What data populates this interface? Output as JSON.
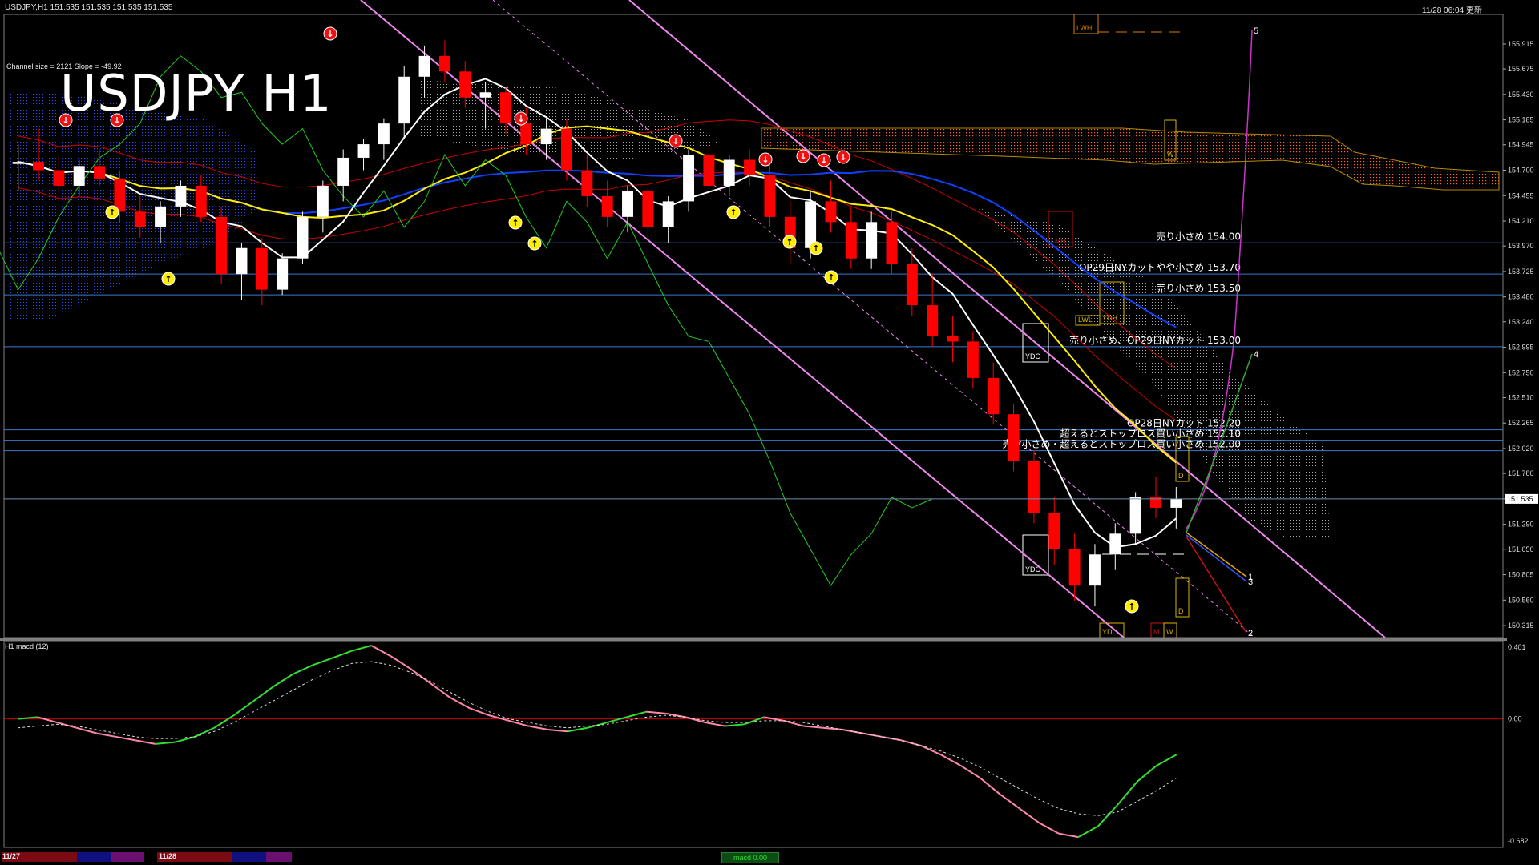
{
  "header": {
    "symbol_info": "USDJPY,H1  151.535 151.535 151.535 151.535",
    "timestamp": "11/28 06:04 更新",
    "channel_info": "Channel size = 2121 Slope = -49.92",
    "big_title": "USDJPY H1"
  },
  "subwindow": {
    "label": "H1  macd (12)"
  },
  "footer": {
    "dates": [
      "11/27",
      "11/28"
    ],
    "button": "macd 0.00"
  },
  "colors": {
    "bull_candle": "#ffffff",
    "bear_candle": "#ff0000",
    "macd_up": "#33dd33",
    "macd_down": "#ff88aa",
    "signal": "#dddddd",
    "sma_white": "#ffffff",
    "sma_yellow": "#ffee00",
    "sma_blue": "#1040ff",
    "chikou": "#22cc22",
    "envelope": "#cc0000",
    "channel": "#ee88ee",
    "cloud": "#ff6633",
    "level_line": "#3a7ad0",
    "zero_line": "#cc0000"
  },
  "icons": {
    "buy_marker": "up-arrow-circle-icon",
    "sell_marker": "down-arrow-circle-icon"
  },
  "chart_data": [
    {
      "type": "candlestick",
      "title": "USDJPY H1",
      "price_axis": {
        "ylim": [
          150.2,
          156.2
        ],
        "tick_labels": [
          "155.915",
          "155.675",
          "155.430",
          "155.185",
          "154.945",
          "154.700",
          "154.455",
          "154.210",
          "153.970",
          "153.725",
          "153.480",
          "153.240",
          "152.995",
          "152.750",
          "152.510",
          "152.265",
          "152.020",
          "151.780",
          "151.535",
          "151.290",
          "151.050",
          "150.805",
          "150.560",
          "150.315"
        ],
        "current_price": "151.535"
      },
      "horizontal_levels": [
        {
          "price": 154.0,
          "label": "売り小さめ 154.00"
        },
        {
          "price": 153.7,
          "label": "OP29日NYカットやや小さめ 153.70"
        },
        {
          "price": 153.5,
          "label": "売り小さめ 153.50"
        },
        {
          "price": 153.0,
          "label": "売り小さめ、OP29日NYカット 153.00"
        },
        {
          "price": 152.2,
          "label": "OP28日NYカット 152.20"
        },
        {
          "price": 152.1,
          "label": "超えるとストップロス買い小さめ 152.10"
        },
        {
          "price": 152.0,
          "label": "売り小さめ・超えるとストップロス買い小さめ 152.00"
        }
      ],
      "box_labels": [
        "LWH",
        "W",
        "LMH",
        "LWL",
        "YDH",
        "YDO",
        "YDC",
        "D",
        "D",
        "YDL",
        "M",
        "W"
      ],
      "projection_labels": [
        "5",
        "4",
        "1",
        "3",
        "2"
      ],
      "candles": [
        {
          "o": 154.76,
          "h": 154.95,
          "l": 154.5,
          "c": 154.78
        },
        {
          "o": 154.78,
          "h": 155.1,
          "l": 154.6,
          "c": 154.7
        },
        {
          "o": 154.7,
          "h": 154.85,
          "l": 154.4,
          "c": 154.55
        },
        {
          "o": 154.55,
          "h": 154.8,
          "l": 154.45,
          "c": 154.74
        },
        {
          "o": 154.74,
          "h": 154.9,
          "l": 154.55,
          "c": 154.62
        },
        {
          "o": 154.62,
          "h": 154.7,
          "l": 154.2,
          "c": 154.3
        },
        {
          "o": 154.3,
          "h": 154.45,
          "l": 154.05,
          "c": 154.15
        },
        {
          "o": 154.15,
          "h": 154.4,
          "l": 154.0,
          "c": 154.35
        },
        {
          "o": 154.35,
          "h": 154.6,
          "l": 154.25,
          "c": 154.55
        },
        {
          "o": 154.55,
          "h": 154.65,
          "l": 154.2,
          "c": 154.25
        },
        {
          "o": 154.25,
          "h": 154.35,
          "l": 153.6,
          "c": 153.7
        },
        {
          "o": 153.7,
          "h": 154.0,
          "l": 153.45,
          "c": 153.95
        },
        {
          "o": 153.95,
          "h": 154.05,
          "l": 153.4,
          "c": 153.55
        },
        {
          "o": 153.55,
          "h": 153.9,
          "l": 153.5,
          "c": 153.85
        },
        {
          "o": 153.85,
          "h": 154.3,
          "l": 153.8,
          "c": 154.25
        },
        {
          "o": 154.25,
          "h": 154.6,
          "l": 154.1,
          "c": 154.55
        },
        {
          "o": 154.55,
          "h": 154.9,
          "l": 154.4,
          "c": 154.82
        },
        {
          "o": 154.82,
          "h": 155.0,
          "l": 154.7,
          "c": 154.95
        },
        {
          "o": 154.95,
          "h": 155.2,
          "l": 154.8,
          "c": 155.15
        },
        {
          "o": 155.15,
          "h": 155.7,
          "l": 155.0,
          "c": 155.6
        },
        {
          "o": 155.6,
          "h": 155.9,
          "l": 155.4,
          "c": 155.8
        },
        {
          "o": 155.8,
          "h": 155.95,
          "l": 155.55,
          "c": 155.65
        },
        {
          "o": 155.65,
          "h": 155.75,
          "l": 155.3,
          "c": 155.4
        },
        {
          "o": 155.4,
          "h": 155.55,
          "l": 155.1,
          "c": 155.45
        },
        {
          "o": 155.45,
          "h": 155.5,
          "l": 155.05,
          "c": 155.15
        },
        {
          "o": 155.15,
          "h": 155.3,
          "l": 154.85,
          "c": 154.95
        },
        {
          "o": 154.95,
          "h": 155.2,
          "l": 154.8,
          "c": 155.1
        },
        {
          "o": 155.1,
          "h": 155.2,
          "l": 154.6,
          "c": 154.7
        },
        {
          "o": 154.7,
          "h": 154.85,
          "l": 154.35,
          "c": 154.45
        },
        {
          "o": 154.45,
          "h": 154.6,
          "l": 154.15,
          "c": 154.25
        },
        {
          "o": 154.25,
          "h": 154.55,
          "l": 154.1,
          "c": 154.5
        },
        {
          "o": 154.5,
          "h": 154.6,
          "l": 154.05,
          "c": 154.15
        },
        {
          "o": 154.15,
          "h": 154.45,
          "l": 154.0,
          "c": 154.4
        },
        {
          "o": 154.4,
          "h": 154.9,
          "l": 154.3,
          "c": 154.85
        },
        {
          "o": 154.85,
          "h": 154.95,
          "l": 154.45,
          "c": 154.55
        },
        {
          "o": 154.55,
          "h": 154.85,
          "l": 154.45,
          "c": 154.8
        },
        {
          "o": 154.8,
          "h": 154.9,
          "l": 154.55,
          "c": 154.65
        },
        {
          "o": 154.65,
          "h": 154.8,
          "l": 154.15,
          "c": 154.25
        },
        {
          "o": 154.25,
          "h": 154.4,
          "l": 153.8,
          "c": 153.95
        },
        {
          "o": 153.95,
          "h": 154.5,
          "l": 153.85,
          "c": 154.4
        },
        {
          "o": 154.4,
          "h": 154.6,
          "l": 154.1,
          "c": 154.2
        },
        {
          "o": 154.2,
          "h": 154.35,
          "l": 153.75,
          "c": 153.85
        },
        {
          "o": 153.85,
          "h": 154.3,
          "l": 153.75,
          "c": 154.2
        },
        {
          "o": 154.2,
          "h": 154.3,
          "l": 153.7,
          "c": 153.8
        },
        {
          "o": 153.8,
          "h": 153.95,
          "l": 153.3,
          "c": 153.4
        },
        {
          "o": 153.4,
          "h": 153.7,
          "l": 153.0,
          "c": 153.1
        },
        {
          "o": 153.1,
          "h": 153.3,
          "l": 152.85,
          "c": 153.05
        },
        {
          "o": 153.05,
          "h": 153.15,
          "l": 152.6,
          "c": 152.7
        },
        {
          "o": 152.7,
          "h": 152.85,
          "l": 152.25,
          "c": 152.35
        },
        {
          "o": 152.35,
          "h": 152.45,
          "l": 151.8,
          "c": 151.9
        },
        {
          "o": 151.9,
          "h": 152.0,
          "l": 151.3,
          "c": 151.4
        },
        {
          "o": 151.4,
          "h": 151.55,
          "l": 150.9,
          "c": 151.05
        },
        {
          "o": 151.05,
          "h": 151.2,
          "l": 150.55,
          "c": 150.7
        },
        {
          "o": 150.7,
          "h": 151.1,
          "l": 150.5,
          "c": 151.0
        },
        {
          "o": 151.0,
          "h": 151.3,
          "l": 150.85,
          "c": 151.2
        },
        {
          "o": 151.2,
          "h": 151.6,
          "l": 151.1,
          "c": 151.55
        },
        {
          "o": 151.55,
          "h": 151.75,
          "l": 151.35,
          "c": 151.45
        },
        {
          "o": 151.45,
          "h": 151.65,
          "l": 151.25,
          "c": 151.535
        }
      ]
    },
    {
      "type": "line",
      "title": "H1  macd (12)",
      "ylim": [
        -0.682,
        0.401
      ],
      "tick_labels": [
        "0.401",
        "0.00",
        "-0.682"
      ],
      "series": [
        {
          "values": [
            0.0,
            0.01,
            -0.02,
            -0.05,
            -0.08,
            -0.1,
            -0.12,
            -0.14,
            -0.13,
            -0.1,
            -0.05,
            0.02,
            0.1,
            0.18,
            0.25,
            0.3,
            0.34,
            0.38,
            0.41,
            0.35,
            0.28,
            0.2,
            0.12,
            0.06,
            0.02,
            -0.01,
            -0.04,
            -0.06,
            -0.07,
            -0.05,
            -0.02,
            0.01,
            0.04,
            0.03,
            0.01,
            -0.02,
            -0.04,
            -0.03,
            0.01,
            -0.01,
            -0.04,
            -0.05,
            -0.06,
            -0.08,
            -0.1,
            -0.12,
            -0.15,
            -0.2,
            -0.26,
            -0.33,
            -0.42,
            -0.5,
            -0.58,
            -0.64,
            -0.66,
            -0.6,
            -0.48,
            -0.35,
            -0.26,
            -0.2
          ]
        },
        {
          "values": [
            -0.05,
            -0.04,
            -0.03,
            -0.04,
            -0.06,
            -0.08,
            -0.1,
            -0.11,
            -0.11,
            -0.1,
            -0.07,
            -0.02,
            0.04,
            0.1,
            0.16,
            0.22,
            0.27,
            0.31,
            0.32,
            0.3,
            0.26,
            0.21,
            0.15,
            0.09,
            0.04,
            0.0,
            -0.02,
            -0.04,
            -0.05,
            -0.04,
            -0.03,
            -0.01,
            0.01,
            0.02,
            0.01,
            -0.01,
            -0.02,
            -0.02,
            -0.01,
            -0.01,
            -0.02,
            -0.04,
            -0.06,
            -0.08,
            -0.1,
            -0.12,
            -0.15,
            -0.18,
            -0.22,
            -0.27,
            -0.33,
            -0.39,
            -0.45,
            -0.5,
            -0.53,
            -0.54,
            -0.52,
            -0.46,
            -0.4,
            -0.33
          ]
        }
      ]
    }
  ]
}
